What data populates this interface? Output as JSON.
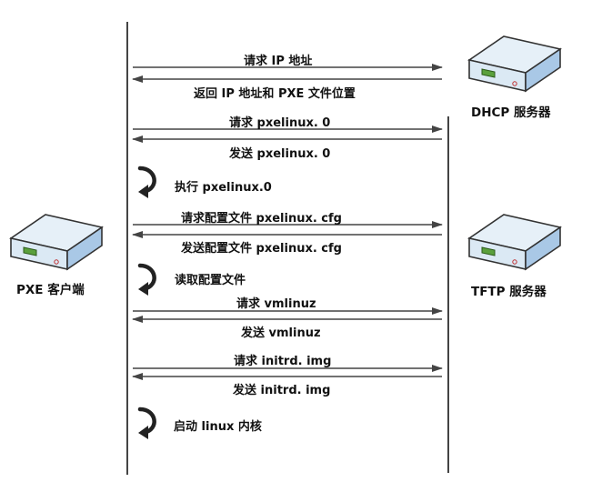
{
  "nodes": {
    "client": {
      "label": "PXE 客户端",
      "icon": "server-icon"
    },
    "dhcp": {
      "label": "DHCP 服务器",
      "icon": "server-icon"
    },
    "tftp": {
      "label": "TFTP 服务器",
      "icon": "server-icon"
    }
  },
  "messages": [
    {
      "text": "请求 IP 地址",
      "dir": "right"
    },
    {
      "text": "返回 IP 地址和 PXE 文件位置",
      "dir": "left"
    },
    {
      "text": "请求 pxelinux. 0",
      "dir": "right"
    },
    {
      "text": "发送 pxelinux. 0",
      "dir": "left"
    },
    {
      "text": "请求配置文件 pxelinux. cfg",
      "dir": "right"
    },
    {
      "text": "发送配置文件 pxelinux. cfg",
      "dir": "left"
    },
    {
      "text": "请求 vmlinuz",
      "dir": "right"
    },
    {
      "text": "发送 vmlinuz",
      "dir": "left"
    },
    {
      "text": "请求 initrd. img",
      "dir": "right"
    },
    {
      "text": "发送 initrd. img",
      "dir": "left"
    }
  ],
  "steps": [
    {
      "text": "执行 pxelinux.0",
      "icon": "curved-arrow-icon"
    },
    {
      "text": "读取配置文件",
      "icon": "curved-arrow-icon"
    },
    {
      "text": "启动 linux 内核",
      "icon": "curved-arrow-icon"
    }
  ],
  "colors": {
    "line": "#444444",
    "server_top": "#e6f0f8",
    "server_side": "#a9c8e6",
    "led": "#5aa03c"
  }
}
